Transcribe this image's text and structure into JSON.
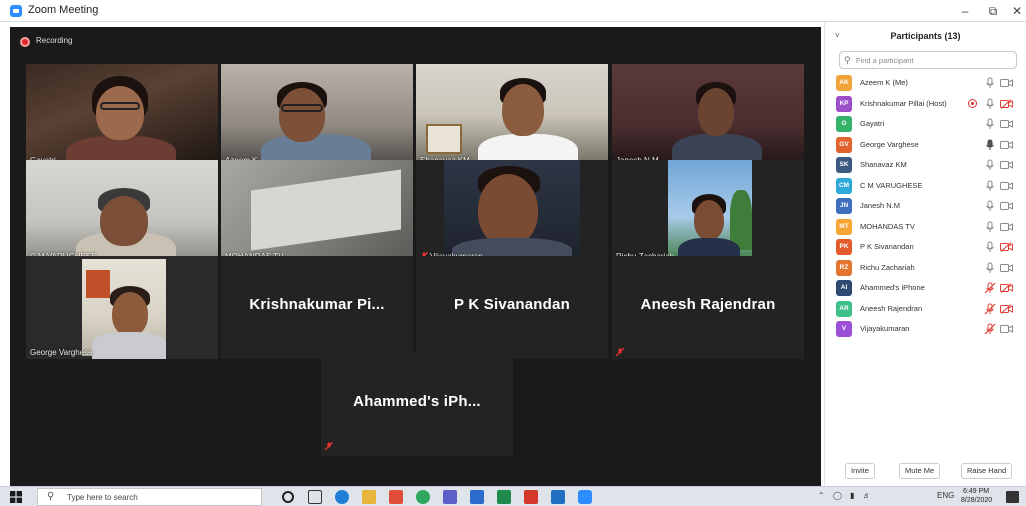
{
  "window": {
    "title": "Zoom Meeting",
    "minimize": "–",
    "restore": "⧉",
    "close": "✕"
  },
  "meeting": {
    "recording_label": "Recording",
    "tiles": [
      {
        "name": "Gayatri"
      },
      {
        "name": "Azeem K"
      },
      {
        "name": "Shanavaz KM"
      },
      {
        "name": "Janesh N.M"
      },
      {
        "name": "C M VARUGHESE"
      },
      {
        "name": "MOHANDAS TV"
      },
      {
        "name": "Vijayakumaran"
      },
      {
        "name": "Richu Zachariah"
      },
      {
        "name": "George Varghese"
      },
      {
        "name": "Krishnakumar  Pi..."
      },
      {
        "name": "P K Sivanandan"
      },
      {
        "name": "Aneesh Rajendran"
      },
      {
        "name": "Ahammed's iPh..."
      }
    ]
  },
  "panel": {
    "collapse": "˅",
    "title": "Participants (13)",
    "search_placeholder": "Find a participant",
    "participants": [
      {
        "initials": "AK",
        "name": "Azeem K (Me)",
        "color": "#f0a33a"
      },
      {
        "initials": "KP",
        "name": "Krishnakumar Pillai (Host)",
        "color": "#9b4fc8"
      },
      {
        "initials": "G",
        "name": "Gayatri",
        "color": "#35b368"
      },
      {
        "initials": "GV",
        "name": "George Varghese",
        "color": "#e0622c"
      },
      {
        "initials": "SK",
        "name": "Shanavaz KM",
        "color": "#3d5a80"
      },
      {
        "initials": "CM",
        "name": "C M VARUGHESE",
        "color": "#2ea9d9"
      },
      {
        "initials": "JN",
        "name": "Janesh N.M",
        "color": "#3f6fbf"
      },
      {
        "initials": "MT",
        "name": "MOHANDAS TV",
        "color": "#f6a532"
      },
      {
        "initials": "PK",
        "name": "P K Sivanandan",
        "color": "#e35a2b"
      },
      {
        "initials": "RZ",
        "name": "Richu Zachariah",
        "color": "#e5762f"
      },
      {
        "initials": "AI",
        "name": "Ahammed's iPhone",
        "color": "#2f4a73"
      },
      {
        "initials": "AR",
        "name": "Aneesh Rajendran",
        "color": "#3fbf8a"
      },
      {
        "initials": "V",
        "name": "Vijayakumaran",
        "color": "#9a4fd6"
      }
    ],
    "buttons": {
      "invite": "Invite",
      "mute_me": "Mute Me",
      "raise_hand": "Raise Hand"
    }
  },
  "taskbar": {
    "search_placeholder": "Type here to search",
    "tray_lang": "ENG",
    "time": "6:49 PM",
    "date": "8/28/2020"
  }
}
